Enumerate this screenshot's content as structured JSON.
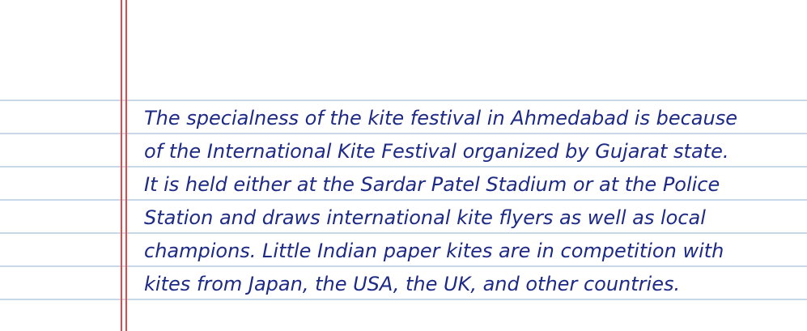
{
  "note": {
    "lines": [
      "The specialness of the kite festival in Ahmedabad is because",
      "of the International Kite Festival organized by Gujarat state.",
      "It is held either at the Sardar Patel Stadium or at the Police",
      "Station and draws international kite flyers as well as local",
      "champions. Little Indian paper kites are in competition with",
      "kites from Japan, the USA, the UK, and other countries."
    ]
  },
  "colors": {
    "paper": "#ffffff",
    "ruled_line": "#c9d8e8",
    "margin_line": "#e24a4a",
    "ink": "#1d2a86"
  }
}
